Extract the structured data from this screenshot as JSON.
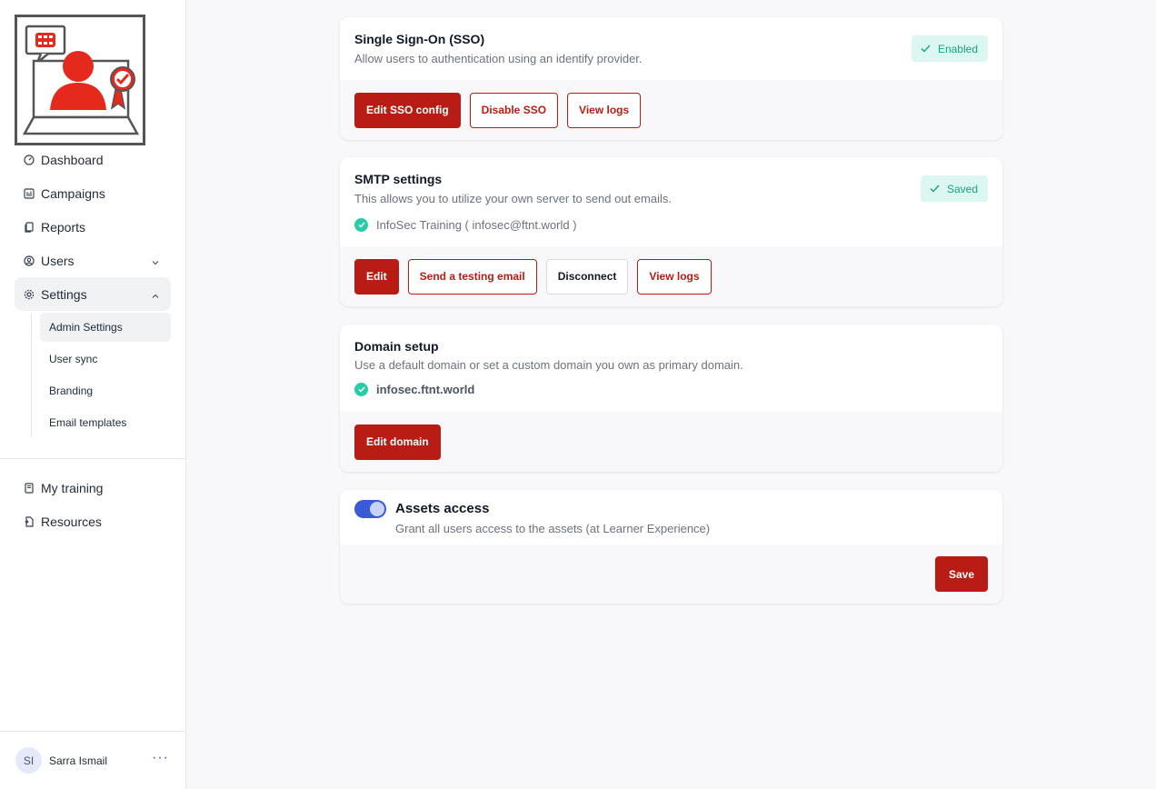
{
  "sidebar": {
    "nav": [
      {
        "label": "Dashboard",
        "icon": "gauge-icon"
      },
      {
        "label": "Campaigns",
        "icon": "campaigns-icon"
      },
      {
        "label": "Reports",
        "icon": "reports-icon"
      },
      {
        "label": "Users",
        "icon": "user-circle-icon"
      },
      {
        "label": "Settings",
        "icon": "gear-icon"
      }
    ],
    "settings_sub": [
      "Admin Settings",
      "User sync",
      "Branding",
      "Email templates"
    ],
    "nav2": [
      {
        "label": "My training",
        "icon": "book-icon"
      },
      {
        "label": "Resources",
        "icon": "resources-icon"
      }
    ],
    "user": {
      "initials": "SI",
      "name": "Sarra Ismail",
      "more": "···"
    }
  },
  "sso": {
    "title": "Single Sign-On (SSO)",
    "desc": "Allow users to authentication using an identify provider.",
    "badge": "Enabled",
    "buttons": {
      "edit": "Edit SSO config",
      "disable": "Disable SSO",
      "logs": "View logs"
    }
  },
  "smtp": {
    "title": "SMTP settings",
    "desc": "This allows you to utilize your own server to send out emails.",
    "badge": "Saved",
    "status": "InfoSec Training ( infosec@ftnt.world )",
    "buttons": {
      "edit": "Edit",
      "test": "Send a testing email",
      "disconnect": "Disconnect",
      "logs": "View logs"
    }
  },
  "domain": {
    "title": "Domain setup",
    "desc": "Use a default domain or set a custom domain you own as primary domain.",
    "status": "infosec.ftnt.world",
    "buttons": {
      "edit": "Edit domain"
    }
  },
  "assets": {
    "title": "Assets access",
    "desc": "Grant all users access to the assets (at Learner Experience)",
    "enabled": true,
    "buttons": {
      "save": "Save"
    }
  },
  "colors": {
    "brand_red": "#b91c14",
    "success_green": "#2bcba8",
    "toggle_blue": "#3b5bd6"
  }
}
